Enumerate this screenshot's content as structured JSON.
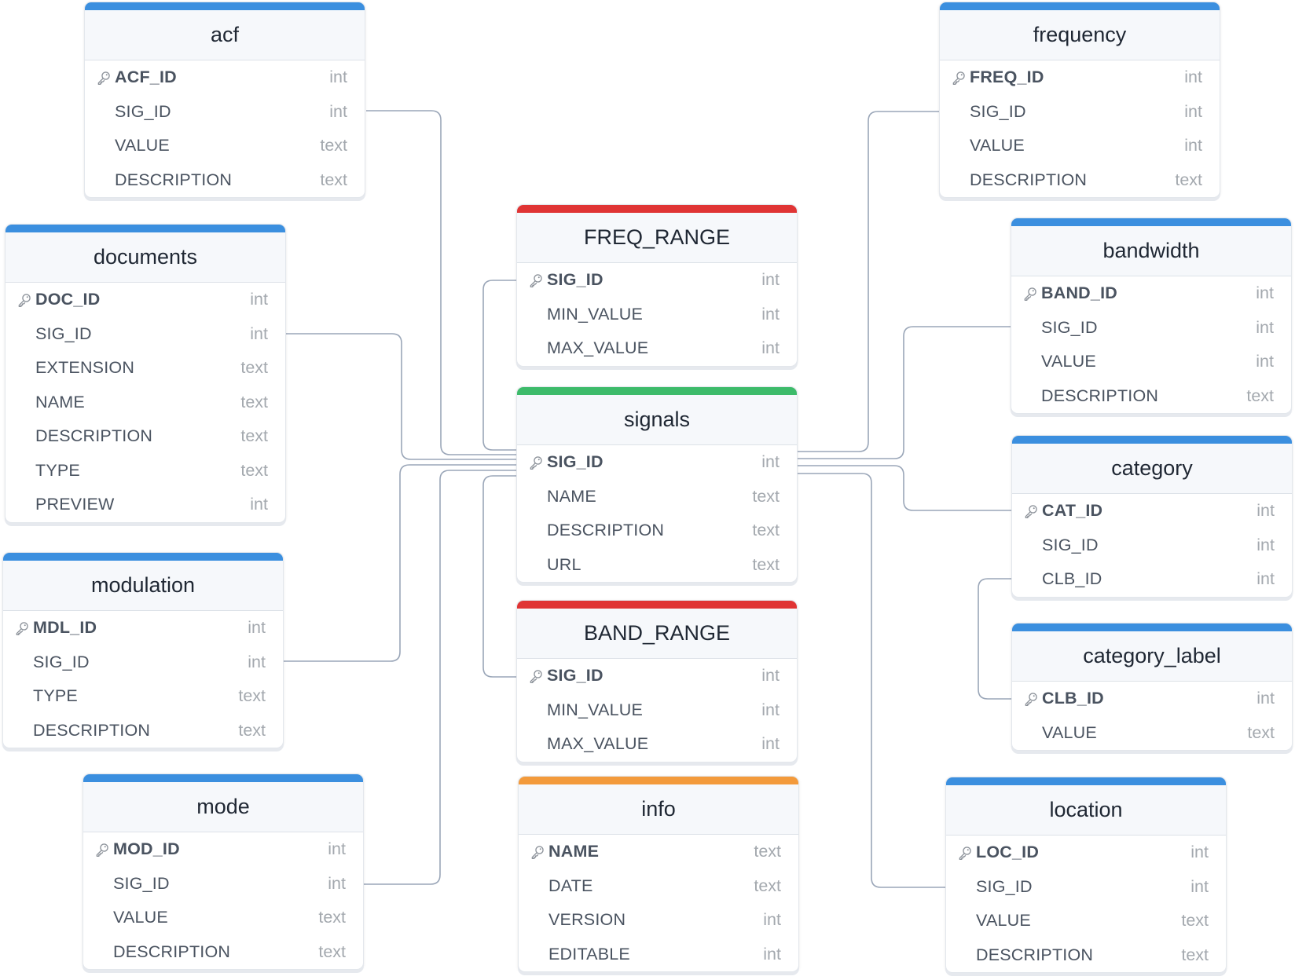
{
  "colors": {
    "default_header": "#3b8fdf",
    "link_header": "#e03434",
    "center_header": "#3dbb6a",
    "info_header": "#f39a3b",
    "connector": "#9aa6b8"
  },
  "tables": [
    {
      "id": "acf",
      "name": "acf",
      "accent": "default_header",
      "fields": [
        {
          "name": "ACF_ID",
          "type": "int",
          "pk": true
        },
        {
          "name": "SIG_ID",
          "type": "int",
          "pk": false
        },
        {
          "name": "VALUE",
          "type": "text",
          "pk": false
        },
        {
          "name": "DESCRIPTION",
          "type": "text",
          "pk": false
        }
      ]
    },
    {
      "id": "documents",
      "name": "documents",
      "accent": "default_header",
      "fields": [
        {
          "name": "DOC_ID",
          "type": "int",
          "pk": true
        },
        {
          "name": "SIG_ID",
          "type": "int",
          "pk": false
        },
        {
          "name": "EXTENSION",
          "type": "text",
          "pk": false
        },
        {
          "name": "NAME",
          "type": "text",
          "pk": false
        },
        {
          "name": "DESCRIPTION",
          "type": "text",
          "pk": false
        },
        {
          "name": "TYPE",
          "type": "text",
          "pk": false
        },
        {
          "name": "PREVIEW",
          "type": "int",
          "pk": false
        }
      ]
    },
    {
      "id": "modulation",
      "name": "modulation",
      "accent": "default_header",
      "fields": [
        {
          "name": "MDL_ID",
          "type": "int",
          "pk": true
        },
        {
          "name": "SIG_ID",
          "type": "int",
          "pk": false
        },
        {
          "name": "TYPE",
          "type": "text",
          "pk": false
        },
        {
          "name": "DESCRIPTION",
          "type": "text",
          "pk": false
        }
      ]
    },
    {
      "id": "mode",
      "name": "mode",
      "accent": "default_header",
      "fields": [
        {
          "name": "MOD_ID",
          "type": "int",
          "pk": true
        },
        {
          "name": "SIG_ID",
          "type": "int",
          "pk": false
        },
        {
          "name": "VALUE",
          "type": "text",
          "pk": false
        },
        {
          "name": "DESCRIPTION",
          "type": "text",
          "pk": false
        }
      ]
    },
    {
      "id": "freq_range",
      "name": "FREQ_RANGE",
      "accent": "link_header",
      "fields": [
        {
          "name": "SIG_ID",
          "type": "int",
          "pk": true
        },
        {
          "name": "MIN_VALUE",
          "type": "int",
          "pk": false
        },
        {
          "name": "MAX_VALUE",
          "type": "int",
          "pk": false
        }
      ]
    },
    {
      "id": "signals",
      "name": "signals",
      "accent": "center_header",
      "fields": [
        {
          "name": "SIG_ID",
          "type": "int",
          "pk": true
        },
        {
          "name": "NAME",
          "type": "text",
          "pk": false
        },
        {
          "name": "DESCRIPTION",
          "type": "text",
          "pk": false
        },
        {
          "name": "URL",
          "type": "text",
          "pk": false
        }
      ]
    },
    {
      "id": "band_range",
      "name": "BAND_RANGE",
      "accent": "link_header",
      "fields": [
        {
          "name": "SIG_ID",
          "type": "int",
          "pk": true
        },
        {
          "name": "MIN_VALUE",
          "type": "int",
          "pk": false
        },
        {
          "name": "MAX_VALUE",
          "type": "int",
          "pk": false
        }
      ]
    },
    {
      "id": "info",
      "name": "info",
      "accent": "info_header",
      "fields": [
        {
          "name": "NAME",
          "type": "text",
          "pk": true
        },
        {
          "name": "DATE",
          "type": "text",
          "pk": false
        },
        {
          "name": "VERSION",
          "type": "int",
          "pk": false
        },
        {
          "name": "EDITABLE",
          "type": "int",
          "pk": false
        }
      ]
    },
    {
      "id": "frequency",
      "name": "frequency",
      "accent": "default_header",
      "fields": [
        {
          "name": "FREQ_ID",
          "type": "int",
          "pk": true
        },
        {
          "name": "SIG_ID",
          "type": "int",
          "pk": false
        },
        {
          "name": "VALUE",
          "type": "int",
          "pk": false
        },
        {
          "name": "DESCRIPTION",
          "type": "text",
          "pk": false
        }
      ]
    },
    {
      "id": "bandwidth",
      "name": "bandwidth",
      "accent": "default_header",
      "fields": [
        {
          "name": "BAND_ID",
          "type": "int",
          "pk": true
        },
        {
          "name": "SIG_ID",
          "type": "int",
          "pk": false
        },
        {
          "name": "VALUE",
          "type": "int",
          "pk": false
        },
        {
          "name": "DESCRIPTION",
          "type": "text",
          "pk": false
        }
      ]
    },
    {
      "id": "category",
      "name": "category",
      "accent": "default_header",
      "fields": [
        {
          "name": "CAT_ID",
          "type": "int",
          "pk": true
        },
        {
          "name": "SIG_ID",
          "type": "int",
          "pk": false
        },
        {
          "name": "CLB_ID",
          "type": "int",
          "pk": false
        }
      ]
    },
    {
      "id": "category_label",
      "name": "category_label",
      "accent": "default_header",
      "fields": [
        {
          "name": "CLB_ID",
          "type": "int",
          "pk": true
        },
        {
          "name": "VALUE",
          "type": "text",
          "pk": false
        }
      ]
    },
    {
      "id": "location",
      "name": "location",
      "accent": "default_header",
      "fields": [
        {
          "name": "LOC_ID",
          "type": "int",
          "pk": true
        },
        {
          "name": "SIG_ID",
          "type": "int",
          "pk": false
        },
        {
          "name": "VALUE",
          "type": "text",
          "pk": false
        },
        {
          "name": "DESCRIPTION",
          "type": "text",
          "pk": false
        }
      ]
    }
  ],
  "relations": [
    {
      "from": "acf.SIG_ID",
      "to": "signals.SIG_ID"
    },
    {
      "from": "documents.SIG_ID",
      "to": "signals.SIG_ID"
    },
    {
      "from": "modulation.SIG_ID",
      "to": "signals.SIG_ID"
    },
    {
      "from": "mode.SIG_ID",
      "to": "signals.SIG_ID"
    },
    {
      "from": "freq_range.SIG_ID",
      "to": "signals.SIG_ID"
    },
    {
      "from": "band_range.SIG_ID",
      "to": "signals.SIG_ID"
    },
    {
      "from": "frequency.SIG_ID",
      "to": "signals.SIG_ID"
    },
    {
      "from": "bandwidth.SIG_ID",
      "to": "signals.SIG_ID"
    },
    {
      "from": "category.CAT_ID",
      "to": "signals.SIG_ID"
    },
    {
      "from": "location.SIG_ID",
      "to": "signals.SIG_ID"
    },
    {
      "from": "category.CLB_ID",
      "to": "category_label.CLB_ID"
    }
  ]
}
